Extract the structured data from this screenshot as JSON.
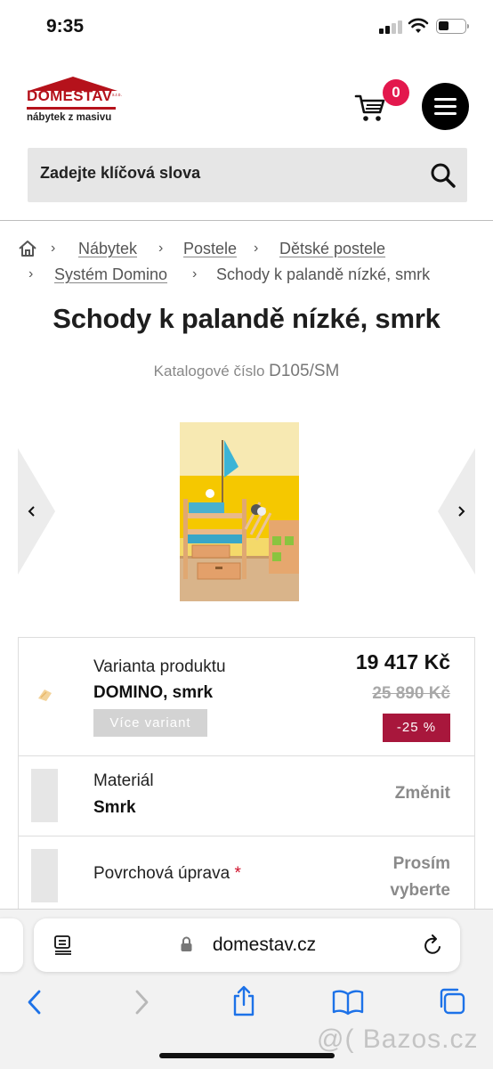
{
  "status_bar": {
    "time": "9:35"
  },
  "header": {
    "logo_name": "DOMESTAV",
    "logo_suffix": "s.r.o.",
    "logo_tagline": "nábytek z masivu",
    "cart_count": "0"
  },
  "search": {
    "placeholder": "Zadejte klíčová slova"
  },
  "breadcrumb": {
    "items": [
      "Nábytek",
      "Postele",
      "Dětské postele",
      "Systém Domino"
    ],
    "current": "Schody k palandě nízké, smrk"
  },
  "product": {
    "title": "Schody k palandě nízké, smrk",
    "catalog_label": "Katalogové číslo",
    "catalog_number": "D105/SM",
    "variant_label": "Varianta produktu",
    "variant_value": "DOMINO, smrk",
    "more_variants": "Více variant",
    "price": "19 417 Kč",
    "old_price": "25 890 Kč",
    "discount": "-25 %",
    "material_label": "Materiál",
    "material_value": "Smrk",
    "material_action": "Změnit",
    "surface_label": "Povrchová úprava",
    "surface_required": "*",
    "surface_action": "Prosím vyberte"
  },
  "browser": {
    "url": "domestav.cz"
  },
  "watermark": "@( Bazos.cz",
  "colors": {
    "accent": "#e3184d",
    "discount": "#a8173c",
    "brand": "#b5121b"
  }
}
